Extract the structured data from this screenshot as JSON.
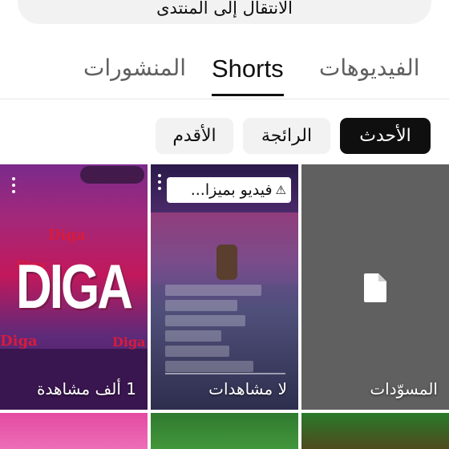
{
  "header": {
    "go_to_forum_label": "الانتقال إلى المنتدى"
  },
  "tabs": [
    {
      "label": "الفيديوهات",
      "active": false
    },
    {
      "label": "Shorts",
      "active": true
    },
    {
      "label": "المنشورات",
      "active": false
    }
  ],
  "filters": [
    {
      "label": "الأحدث",
      "selected": true
    },
    {
      "label": "الرائجة",
      "selected": false
    },
    {
      "label": "الأقدم",
      "selected": false
    }
  ],
  "shorts": [
    {
      "views": "1 ألف مشاهدة",
      "thumbnail_text": "DIGA",
      "thumbnail_small_text": "Diga",
      "menu_icon": "more-vert-icon"
    },
    {
      "views": "لا مشاهدات",
      "warning": "فيديو بميزا...",
      "warning_icon": "warning-icon",
      "menu_icon": "more-vert-icon"
    },
    {
      "label": "المسوّدات",
      "icon": "document-icon"
    }
  ],
  "colors": {
    "text_primary": "#0f0f0f",
    "text_secondary": "#606060",
    "chip_bg": "#f2f2f2",
    "chip_selected_bg": "#0f0f0f",
    "drafts_bg": "#606060"
  }
}
